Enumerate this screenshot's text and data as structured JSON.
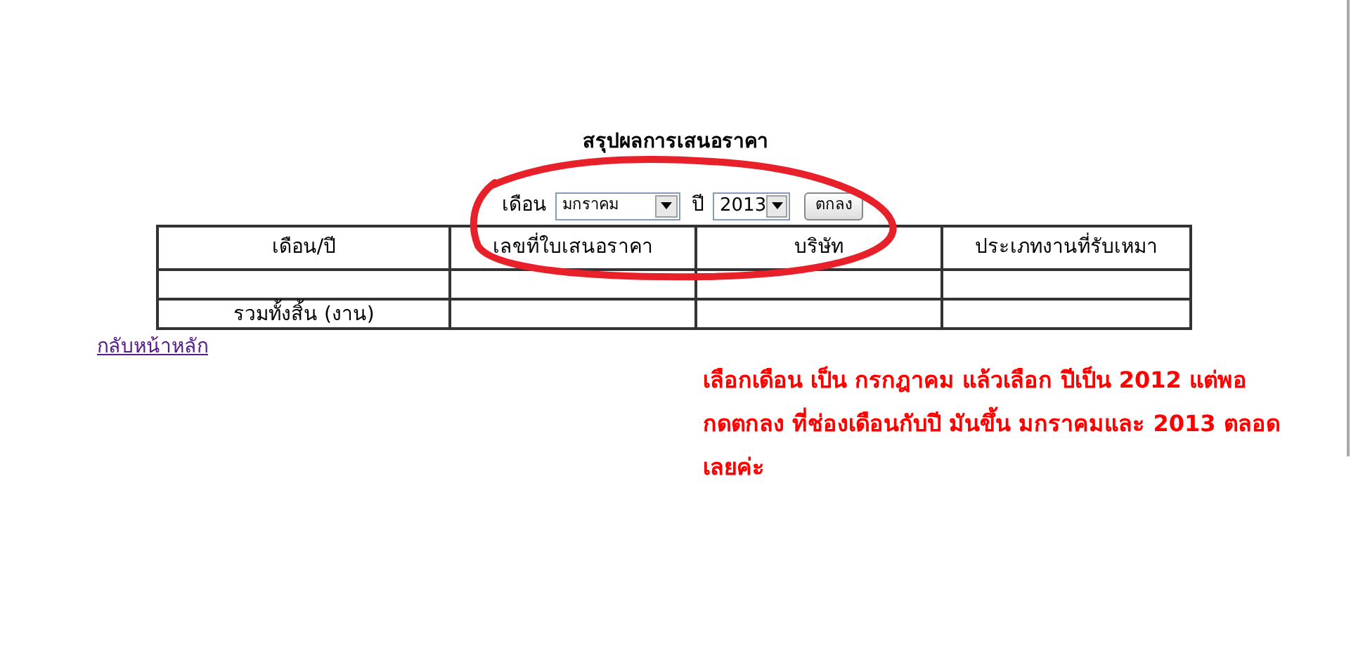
{
  "title": "สรุปผลการเสนอราคา",
  "filter": {
    "month_label": "เดือน",
    "month_value": "มกราคม",
    "year_label": "ปี",
    "year_value": "2013",
    "submit": "ตกลง"
  },
  "table": {
    "columns": [
      "เดือน/ปี",
      "เลขที่ใบเสนอราคา",
      "บริษัท",
      "ประเภทงานที่รับเหมา"
    ],
    "rows": [
      [
        "",
        "",
        "",
        ""
      ],
      [
        "รวมทั้งสิ้น (งาน)",
        "",
        "",
        ""
      ]
    ]
  },
  "back_link": "กลับหน้าหลัก",
  "annotation": {
    "lines": [
      "เลือกเดือน เป็น กรกฎาคม แล้วเลือก ปีเป็น 2012 แต่พอ",
      "กดตกลง ที่ช่องเดือนกับปี มันขึ้น มกราคมและ 2013 ตลอด",
      "เลยค่ะ"
    ]
  }
}
